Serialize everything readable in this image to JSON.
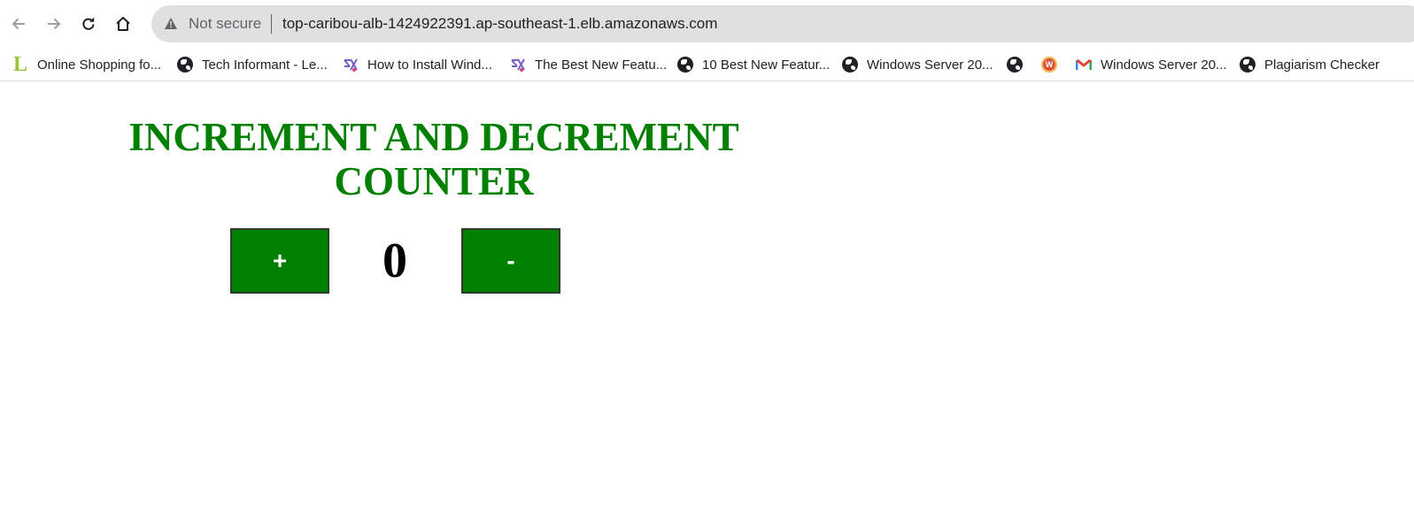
{
  "browser": {
    "security_label": "Not secure",
    "url": "top-caribou-alb-1424922391.ap-southeast-1.elb.amazonaws.com"
  },
  "bookmarks": [
    {
      "label": "Online Shopping fo...",
      "icon": "letter-l-icon"
    },
    {
      "label": "Tech Informant - Le...",
      "icon": "globe-icon"
    },
    {
      "label": "How to Install Wind...",
      "icon": "site-logo-icon"
    },
    {
      "label": "The Best New Featu...",
      "icon": "site-logo-icon"
    },
    {
      "label": "10 Best New Featur...",
      "icon": "globe-icon"
    },
    {
      "label": "Windows Server 20...",
      "icon": "globe-icon"
    },
    {
      "label": "",
      "icon": "globe-icon"
    },
    {
      "label": "",
      "icon": "w-badge-icon"
    },
    {
      "label": "Windows Server 20...",
      "icon": "gmail-icon"
    },
    {
      "label": "Plagiarism Checker",
      "icon": "globe-icon"
    }
  ],
  "page": {
    "title": "INCREMENT AND DECREMENT COUNTER",
    "increment_label": "+",
    "decrement_label": "-",
    "counter_value": "0"
  },
  "colors": {
    "accent": "#008000",
    "omnibox_bg": "#e0e0e0"
  }
}
